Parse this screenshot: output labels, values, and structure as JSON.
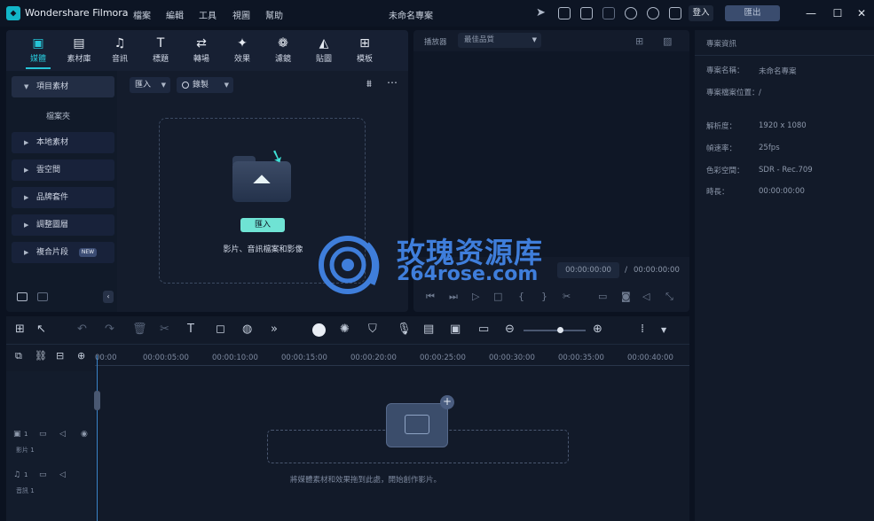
{
  "app": {
    "name": "Wondershare Filmora",
    "project_title": "未命名專案"
  },
  "menu": [
    "檔案",
    "編輯",
    "工具",
    "視圖",
    "幫助"
  ],
  "titlebar": {
    "login": "登入",
    "export": "匯出"
  },
  "media_tabs": [
    "媒體",
    "素材庫",
    "音訊",
    "標題",
    "轉場",
    "效果",
    "濾鏡",
    "貼圖",
    "模板"
  ],
  "sidebar": {
    "project_media": "項目素材",
    "folder": "檔案夾",
    "items": [
      "本地素材",
      "雲空間",
      "品牌套件",
      "調整圖層",
      "複合片段"
    ],
    "new_badge": "NEW"
  },
  "media_toolbar": {
    "import": "匯入",
    "record": "錄製"
  },
  "drop_zone": {
    "button": "匯入",
    "hint": "影片、音訊檔案和影像"
  },
  "preview": {
    "label": "播放器",
    "quality": "最佳品質",
    "timecode_current": "00:00:00:00",
    "timecode_sep": "/",
    "timecode_total": "00:00:00:00"
  },
  "properties": {
    "title": "專案資訊",
    "rows": [
      {
        "key": "專案名稱：",
        "value": "未命名專案"
      },
      {
        "key": "專案檔案位置：",
        "value": "/"
      },
      {
        "key": "解析度：",
        "value": "1920 x 1080"
      },
      {
        "key": "幀速率：",
        "value": "25fps"
      },
      {
        "key": "色彩空間：",
        "value": "SDR - Rec.709"
      },
      {
        "key": "時長：",
        "value": "00:00:00:00"
      }
    ]
  },
  "timeline": {
    "ruler": [
      "00:00",
      "00:00:05:00",
      "00:00:10:00",
      "00:00:15:00",
      "00:00:20:00",
      "00:00:25:00",
      "00:00:30:00",
      "00:00:35:00",
      "00:00:40:00"
    ],
    "tracks": [
      {
        "num": "1",
        "name": "影片 1"
      },
      {
        "num": "1",
        "name": "音訊 1"
      }
    ],
    "hint": "將媒體素材和效果拖到此處，開始創作影片。"
  },
  "watermark": {
    "cn": "玫瑰资源库",
    "url": "264rose.com"
  },
  "colors": {
    "accent": "#27c4d6",
    "background": "#0b1220",
    "watermark": "#3f7edb"
  }
}
